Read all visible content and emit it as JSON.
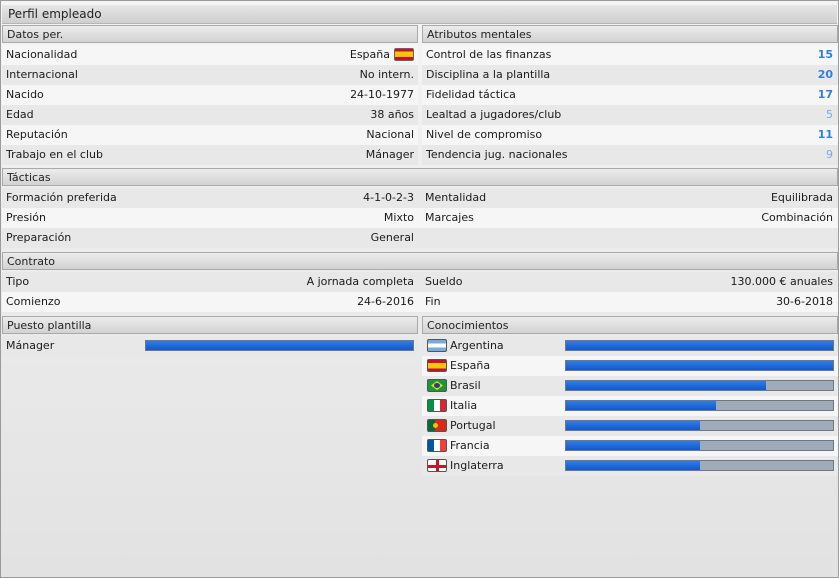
{
  "window_title": "Perfil empleado",
  "datos": {
    "header": "Datos per.",
    "rows": [
      {
        "label": "Nacionalidad",
        "value": "España",
        "flag": "spain-flag-icon"
      },
      {
        "label": "Internacional",
        "value": "No intern."
      },
      {
        "label": "Nacido",
        "value": "24-10-1977"
      },
      {
        "label": "Edad",
        "value": "38 años"
      },
      {
        "label": "Reputación",
        "value": "Nacional"
      },
      {
        "label": "Trabajo en el club",
        "value": "Mánager"
      }
    ]
  },
  "atributos": {
    "header": "Atributos mentales",
    "rows": [
      {
        "label": "Control de las finanzas",
        "value": "15"
      },
      {
        "label": "Disciplina a la plantilla",
        "value": "20"
      },
      {
        "label": "Fidelidad táctica",
        "value": "17"
      },
      {
        "label": "Lealtad a jugadores/club",
        "value": "5"
      },
      {
        "label": "Nivel de compromiso",
        "value": "11"
      },
      {
        "label": "Tendencia jug. nacionales",
        "value": "9"
      }
    ],
    "colors": {
      "strong": "#2f7fe0",
      "weak": "#7fa8e6"
    }
  },
  "tacticas": {
    "header": "Tácticas",
    "rows": [
      {
        "label": "Formación preferida",
        "value": "4-1-0-2-3",
        "label2": "Mentalidad",
        "value2": "Equilibrada"
      },
      {
        "label": "Presión",
        "value": "Mixto",
        "label2": "Marcajes",
        "value2": "Combinación"
      },
      {
        "label": "Preparación",
        "value": "General",
        "label2": "",
        "value2": ""
      }
    ]
  },
  "contrato": {
    "header": "Contrato",
    "rows": [
      {
        "label": "Tipo",
        "value": "A jornada completa",
        "label2": "Sueldo",
        "value2": "130.000 € anuales"
      },
      {
        "label": "Comienzo",
        "value": "24-6-2016",
        "label2": "Fin",
        "value2": "30-6-2018"
      }
    ]
  },
  "puesto": {
    "header": "Puesto plantilla",
    "rows": [
      {
        "label": "Mánager",
        "level": 1.0
      }
    ]
  },
  "conocimientos": {
    "header": "Conocimientos",
    "rows": [
      {
        "country": "Argentina",
        "icon": "argentina-flag-icon",
        "level": 1.0
      },
      {
        "country": "España",
        "icon": "spain-flag-icon",
        "level": 1.0
      },
      {
        "country": "Brasil",
        "icon": "brazil-flag-icon",
        "level": 0.75
      },
      {
        "country": "Italia",
        "icon": "italy-flag-icon",
        "level": 0.56
      },
      {
        "country": "Portugal",
        "icon": "portugal-flag-icon",
        "level": 0.5
      },
      {
        "country": "Francia",
        "icon": "france-flag-icon",
        "level": 0.5
      },
      {
        "country": "Inglaterra",
        "icon": "england-flag-icon",
        "level": 0.5
      }
    ]
  }
}
